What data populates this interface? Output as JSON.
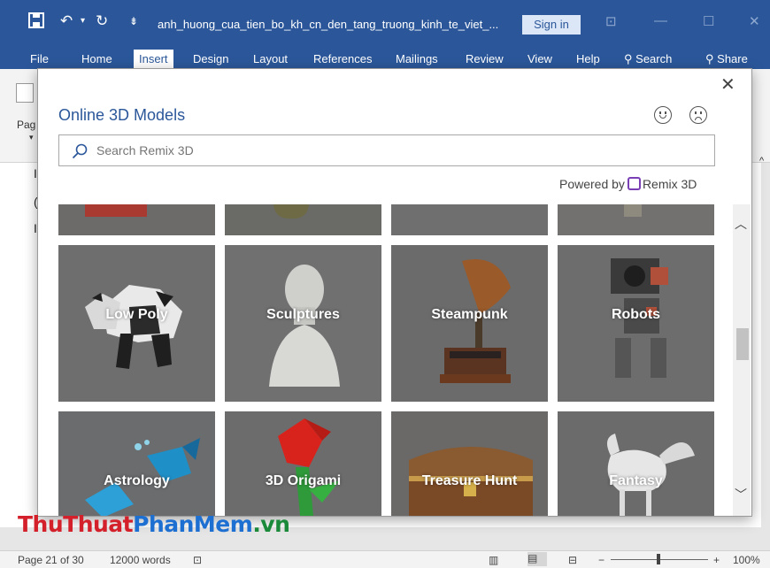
{
  "titlebar": {
    "doc_title": "anh_huong_cua_tien_bo_kh_cn_den_tang_truong_kinh_te_viet_...",
    "sign_in": "Sign in",
    "color": "#2b579a"
  },
  "ribbon": {
    "tabs": [
      "File",
      "Home",
      "Insert",
      "Design",
      "Layout",
      "References",
      "Mailings",
      "Review",
      "View",
      "Help"
    ],
    "active_tab": "Insert",
    "search_label": "Search",
    "share_label": "Share",
    "left_fragment": "Pag"
  },
  "dialog": {
    "title": "Online 3D Models",
    "search_placeholder": "Search Remix 3D",
    "powered_by": "Powered by",
    "provider": "Remix 3D",
    "categories": [
      {
        "label": ""
      },
      {
        "label": ""
      },
      {
        "label": ""
      },
      {
        "label": ""
      },
      {
        "label": "Low Poly"
      },
      {
        "label": "Sculptures"
      },
      {
        "label": "Steampunk"
      },
      {
        "label": "Robots"
      },
      {
        "label": "Astrology"
      },
      {
        "label": "3D Origami"
      },
      {
        "label": "Treasure Hunt"
      },
      {
        "label": "Fantasy"
      }
    ]
  },
  "statusbar": {
    "page": "Page 21 of 30",
    "words": "12000 words",
    "zoom": "100%",
    "zoom_minus": "−",
    "zoom_plus": "+"
  },
  "watermark": {
    "part1": "Thu",
    "part2": "Thuat",
    "part3": "PhanMem",
    "part4": ".vn"
  },
  "colors": {
    "accent": "#2b579a",
    "remix": "#7a3fb5"
  }
}
